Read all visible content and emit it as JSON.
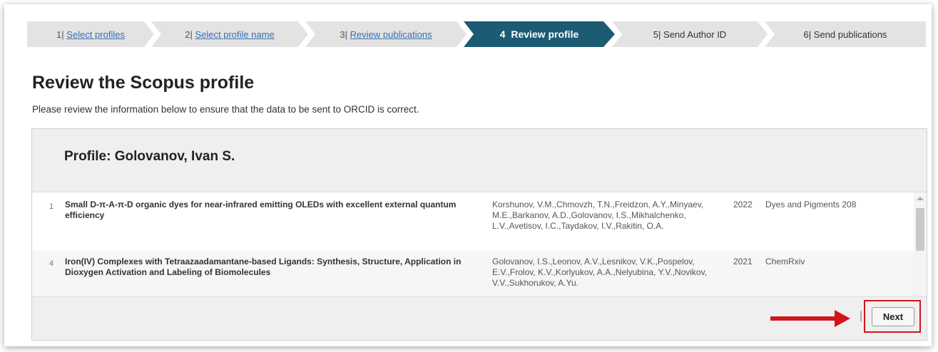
{
  "wizard": {
    "steps": [
      {
        "num": "1",
        "label": "Select profiles",
        "link": true
      },
      {
        "num": "2",
        "label": "Select profile name",
        "link": true
      },
      {
        "num": "3",
        "label": "Review publications",
        "link": true
      },
      {
        "num": "4",
        "label": "Review profile",
        "active": true
      },
      {
        "num": "5",
        "label": "Send Author ID",
        "link": false
      },
      {
        "num": "6",
        "label": "Send publications",
        "link": false
      }
    ],
    "separator": "|",
    "active_color": "#1c5b74",
    "inactive_color": "#e3e3e3"
  },
  "page": {
    "title": "Review the Scopus profile",
    "subtitle": "Please review the information below to ensure that the data to be sent to ORCID is correct."
  },
  "profile": {
    "heading": "Profile: Golovanov, Ivan S."
  },
  "publications": [
    {
      "index": "1",
      "title": "Small D-π-A-π-D organic dyes for near-infrared emitting OLEDs with excellent external quantum efficiency",
      "authors": "Korshunov, V.M.,Chmovzh, T.N.,Freidzon, A.Y.,Minyaev, M.E.,Barkanov, A.D.,Golovanov, I.S.,Mikhalchenko, L.V.,Avetisov, I.C.,Taydakov, I.V.,Rakitin, O.A.",
      "year": "2022",
      "source": "Dyes and Pigments 208"
    },
    {
      "index": "4",
      "title": "Iron(IV) Complexes with Tetraazaadamantane-based Ligands: Synthesis, Structure, Application in Dioxygen Activation and Labeling of Biomolecules",
      "authors": "Golovanov, I.S.,Leonov, A.V.,Lesnikov, V.K.,Pospelov, E.V.,Frolov, K.V.,Korlyukov, A.A.,Nelyubina, Y.V.,Novikov, V.V.,Sukhorukov, A.Yu.",
      "year": "2021",
      "source": "ChemRxiv"
    }
  ],
  "footer": {
    "separator": "|",
    "next_label": "Next",
    "highlight_color": "#d0161c"
  }
}
